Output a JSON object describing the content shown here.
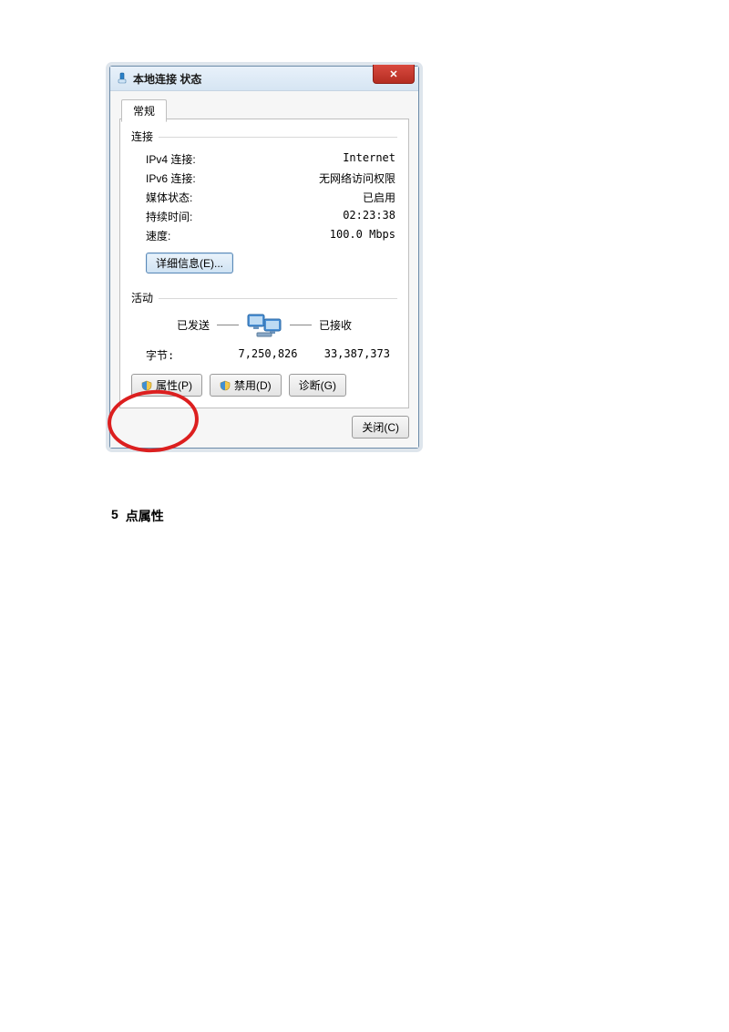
{
  "titlebar": {
    "title": "本地连接 状态",
    "close_glyph": "✕"
  },
  "tab": {
    "general": "常规"
  },
  "connection": {
    "header": "连接",
    "rows": {
      "ipv4_label": "IPv4 连接:",
      "ipv4_value": "Internet",
      "ipv6_label": "IPv6 连接:",
      "ipv6_value": "无网络访问权限",
      "media_label": "媒体状态:",
      "media_value": "已启用",
      "duration_label": "持续时间:",
      "duration_value": "02:23:38",
      "speed_label": "速度:",
      "speed_value": "100.0 Mbps"
    },
    "details_btn": "详细信息(E)..."
  },
  "activity": {
    "header": "活动",
    "sent_label": "已发送",
    "recv_label": "已接收",
    "bytes_label": "字节:",
    "sent_value": "7,250,826",
    "recv_value": "33,387,373"
  },
  "buttons": {
    "properties": "属性(P)",
    "disable": "禁用(D)",
    "diagnose": "诊断(G)",
    "close": "关闭(C)"
  },
  "caption": {
    "num": "5",
    "text": "点属性"
  }
}
